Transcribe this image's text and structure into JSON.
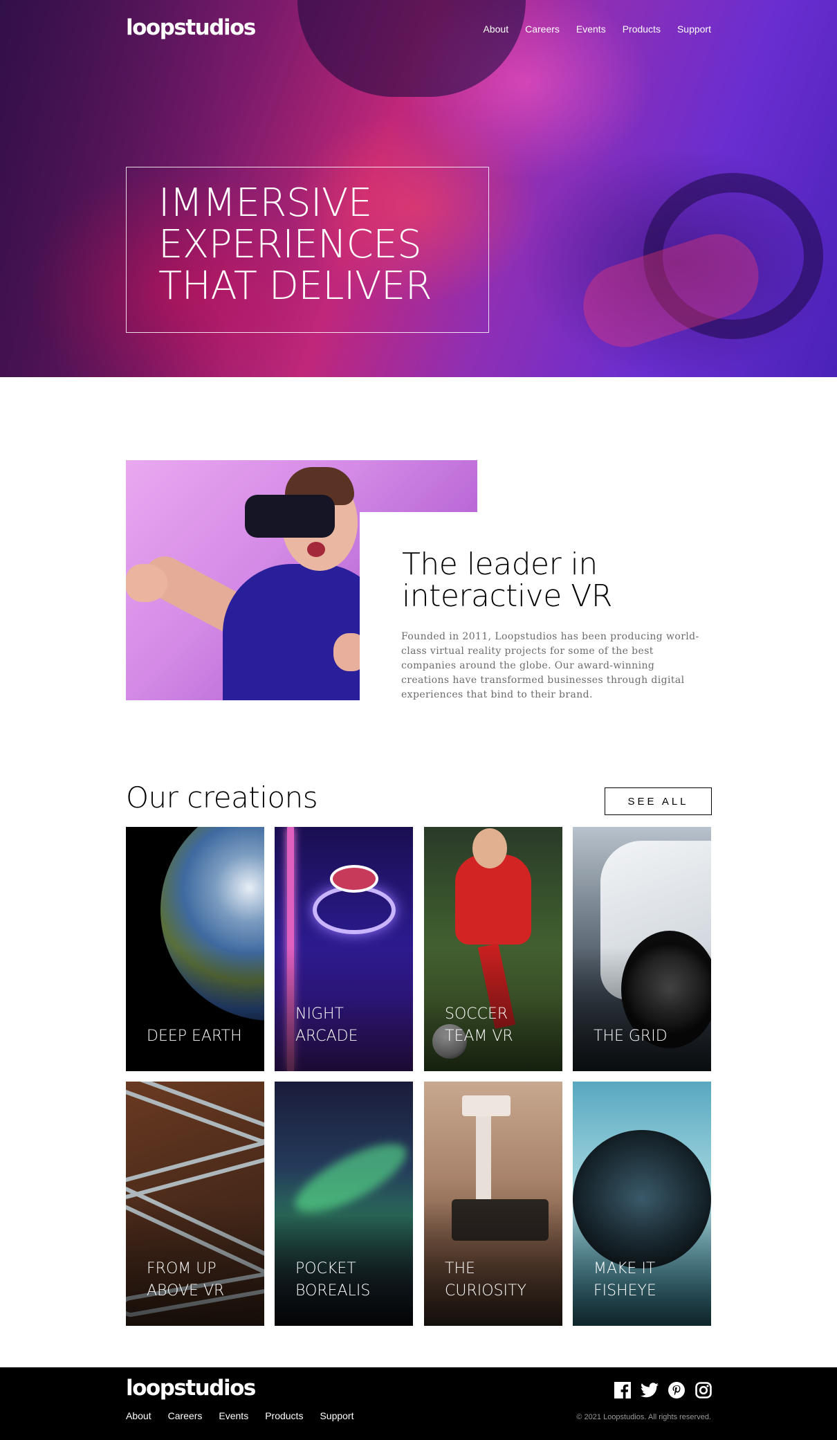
{
  "header": {
    "logo": "loopstudios",
    "nav": [
      "About",
      "Careers",
      "Events",
      "Products",
      "Support"
    ]
  },
  "hero": {
    "title_lines": [
      "IMMERSIVE",
      "EXPERIENCES",
      "THAT DELIVER"
    ]
  },
  "leader": {
    "title_lines": [
      "The leader in",
      "interactive VR"
    ],
    "body": "Founded in 2011, Loopstudios has been producing world-class virtual reality projects for some of the best companies around the globe. Our award-winning creations have transformed businesses through digital experiences that bind to their brand."
  },
  "creations": {
    "title": "Our creations",
    "see_all": "SEE ALL",
    "items": [
      {
        "lines": [
          "DEEP EARTH"
        ]
      },
      {
        "lines": [
          "NIGHT",
          "ARCADE"
        ]
      },
      {
        "lines": [
          "SOCCER",
          "TEAM VR"
        ]
      },
      {
        "lines": [
          "THE GRID"
        ]
      },
      {
        "lines": [
          "FROM UP",
          "ABOVE VR"
        ]
      },
      {
        "lines": [
          "POCKET",
          "BOREALIS"
        ]
      },
      {
        "lines": [
          "THE",
          "CURIOSITY"
        ]
      },
      {
        "lines": [
          "MAKE IT",
          "FISHEYE"
        ]
      }
    ]
  },
  "footer": {
    "logo": "loopstudios",
    "nav": [
      "About",
      "Careers",
      "Events",
      "Products",
      "Support"
    ],
    "socials": [
      "facebook-icon",
      "twitter-icon",
      "pinterest-icon",
      "instagram-icon"
    ],
    "copyright": "© 2021 Loopstudios. All rights reserved."
  }
}
